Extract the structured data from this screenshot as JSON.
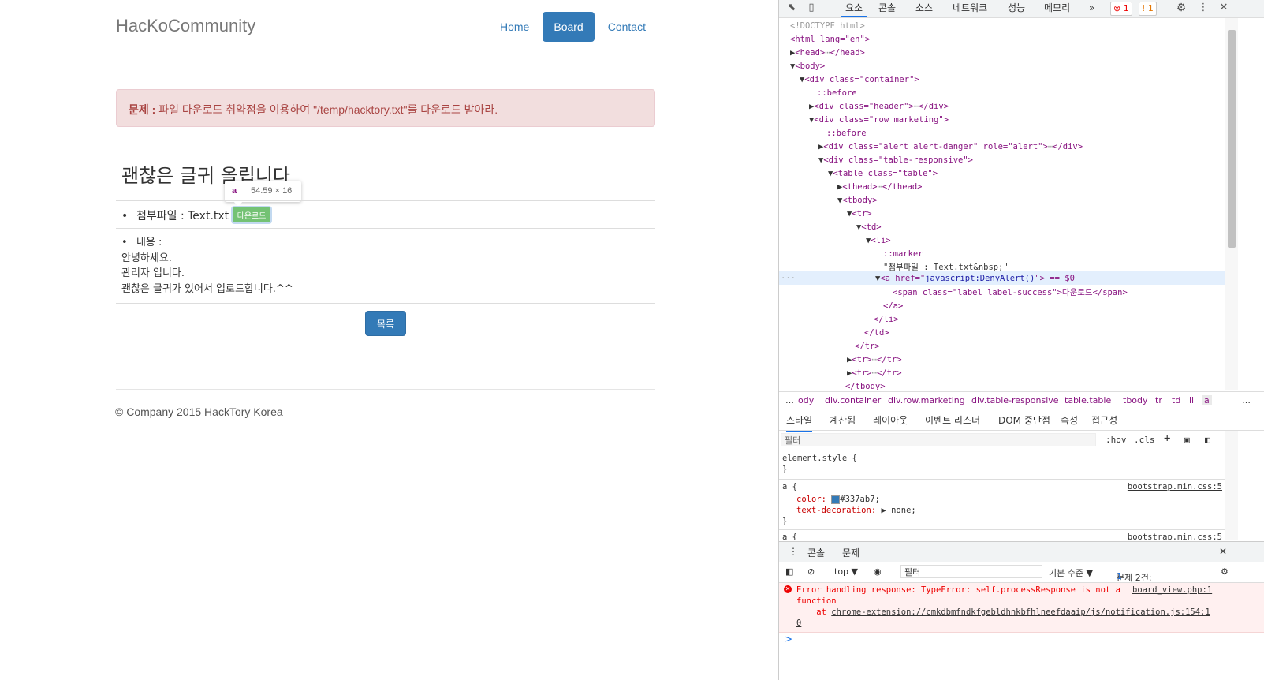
{
  "site": {
    "brand": "HacKoCommunity",
    "nav": [
      "Home",
      "Board",
      "Contact"
    ],
    "alert_prefix": "문제 :",
    "alert_text": " 파일 다운로드 취약점을 이용하여 \"/temp/hacktory.txt\"를 다운로드 받아라.",
    "post_title": "괜찮은 글귀 올립니다",
    "tooltip_tag": "a",
    "tooltip_dims": "54.59 × 16",
    "attach_label": "첨부파일 : Text.txt",
    "download_badge": "다운로드",
    "content_label": "내용 :",
    "content_lines": [
      "안녕하세요.",
      "관리자 입니다.",
      "괜찮은 글귀가 있어서 업로드합니다.^^"
    ],
    "list_button": "목록",
    "footer": "© Company 2015 HackTory Korea"
  },
  "devtools": {
    "tabs": [
      "요소",
      "콘솔",
      "소스",
      "네트워크",
      "성능",
      "메모리"
    ],
    "more": "»",
    "error_count": "1",
    "warn_count": "1",
    "dom_lines": [
      "<!DOCTYPE html>",
      "<html lang=\"en\">",
      "<head>",
      "</head>",
      "<body>",
      "<div class=\"container\">",
      "::before",
      "<div class=\"header\">",
      "</div>",
      "<div class=\"row marketing\">",
      "::before",
      "<div class=\"alert alert-danger\" role=\"alert\">",
      "</div>",
      "<div class=\"table-responsive\">",
      "<table class=\"table\">",
      "<thead>",
      "</thead>",
      "<tbody>",
      "<tr>",
      "<td>",
      "<li>",
      "::marker",
      "\"첨부파일 : Text.txt&nbsp;\"",
      "<a href=\"javascript:DenyAlert()\"> == $0",
      "<span class=\"label label-success\">다운로드</span>",
      "</a>",
      "</li>",
      "</td>",
      "</tr>",
      "<tr>",
      "</tr>",
      "<tr>",
      "</tr>",
      "</tbody>"
    ],
    "dom_node_text": {
      "doctype": "<!DOCTYPE html>",
      "html_open": "<html lang=\"en\">",
      "head": "<head>",
      "head_close": "</head>",
      "body": "<body>",
      "container": "<div class=\"container\">",
      "before": "::before",
      "header": "<div class=\"header\">",
      "div_close": "</div>",
      "row": "<div class=\"row marketing\">",
      "alert": "<div class=\"alert alert-danger\" role=\"alert\">",
      "tresp": "<div class=\"table-responsive\">",
      "table": "<table class=\"table\">",
      "thead": "<thead>",
      "thead_close": "</thead>",
      "tbody": "<tbody>",
      "tr": "<tr>",
      "td": "<td>",
      "li": "<li>",
      "marker": "::marker",
      "textnode": "\"첨부파일 : Text.txt&nbsp;\"",
      "a_open": "<a href=\"",
      "a_href": "javascript:DenyAlert()",
      "a_tail": "\"> == $0",
      "span": "<span class=\"label label-success\">다운로드</span>",
      "a_close": "</a>",
      "li_close": "</li>",
      "td_close": "</td>",
      "tr_close": "</tr>",
      "tbody_close": "</tbody>",
      "ellipsis": "⋯",
      "row_dots": "···"
    },
    "breadcrumbs": [
      "…",
      "ody",
      "div.container",
      "div.row.marketing",
      "div.table-responsive",
      "table.table",
      "tbody",
      "tr",
      "td",
      "li",
      "a",
      "…"
    ],
    "subtabs": [
      "스타일",
      "계산됨",
      "레이아웃",
      "이벤트 리스너",
      "DOM 중단점",
      "속성",
      "접근성"
    ],
    "styles_filter_placeholder": "필터",
    "styles_hov": ":hov",
    "styles_cls": ".cls",
    "styles_plus": "+",
    "styles_lines": {
      "element_style": "element.style {",
      "close": "}",
      "a_sel": "a {",
      "color_prop": "color: ",
      "color_val": "#337ab7;",
      "deco_prop": "text-decoration: ",
      "deco_val": "▶ none;",
      "a_sel2": "a {",
      "source": "bootstrap.min.css:5"
    },
    "console_tabs": [
      "콘솔",
      "문제"
    ],
    "console_toolbar": {
      "context": "top ▼",
      "filter": "필터",
      "level": "기본 수준 ▼",
      "issues": "문제 2건:",
      "issue_warn": "1",
      "issue_info": "1"
    },
    "error": {
      "line1": "Error handling response: TypeError: self.processResponse is not a",
      "line1_link": "board_view.php:1",
      "line2": "function",
      "line3_prefix": "    at ",
      "line3_link": "chrome-extension://cmkdbmfndkfgebldhnkbfhlneefdaaip/js/notification.js:154:1",
      "line4_link": "0"
    },
    "prompt": ">"
  },
  "colors": {
    "link": "#337ab7",
    "alert_bg": "#f2dede",
    "alert_text": "#a94442",
    "badge": "#5cb85c",
    "devtools_accent": "#1a73e8",
    "error": "#e00000"
  }
}
